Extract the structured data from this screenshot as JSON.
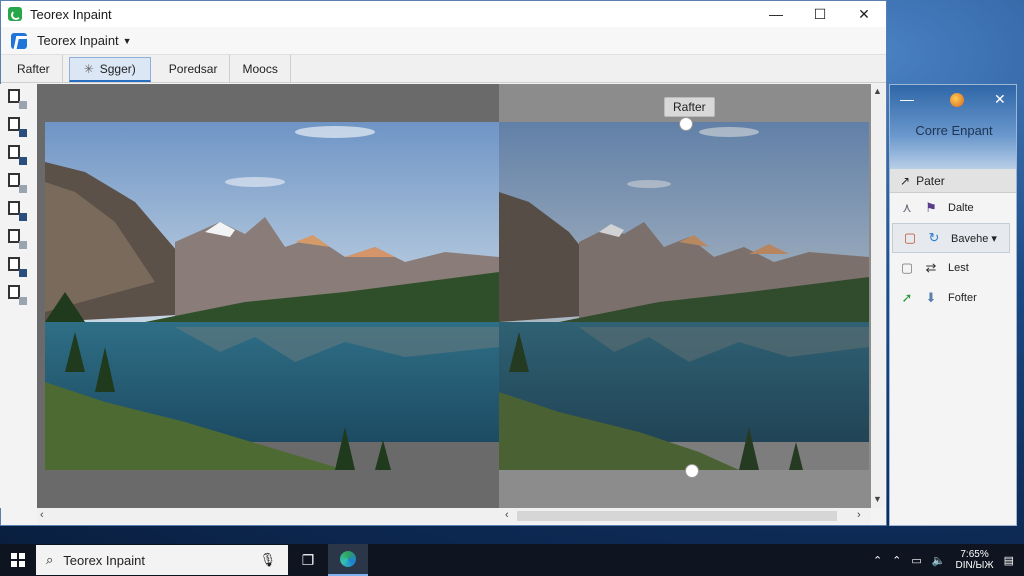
{
  "window": {
    "title": "Teorex Inpaint",
    "controls": {
      "minimize": "—",
      "maximize": "☐",
      "close": "✕"
    }
  },
  "menu": {
    "app_dropdown": "Teorex  Inpaint"
  },
  "toolbar": {
    "items": [
      {
        "label": "Rafter",
        "active": false
      },
      {
        "label": "Sgger)",
        "active": true
      },
      {
        "label": "Poredsar",
        "active": false
      },
      {
        "label": "Moocs",
        "active": false
      }
    ]
  },
  "canvas": {
    "after_label": "Rafter"
  },
  "side_panel": {
    "title": "Corre Enpant",
    "section": "Pater",
    "rows": [
      {
        "label": "Dalte",
        "icon": "pencil-icon"
      },
      {
        "label": "Bavehe ▾",
        "icon": "refresh-icon"
      },
      {
        "label": "Lest",
        "icon": "arrow-icon"
      },
      {
        "label": "Fofter",
        "icon": "down-arrow-icon"
      }
    ]
  },
  "taskbar": {
    "search_text": "Teorex Inpaint",
    "clock_line1": "7:65%",
    "clock_line2": "DIN/ЫЖ"
  },
  "colors": {
    "accent": "#2a6fbf",
    "taskbar": "#0e1520"
  }
}
